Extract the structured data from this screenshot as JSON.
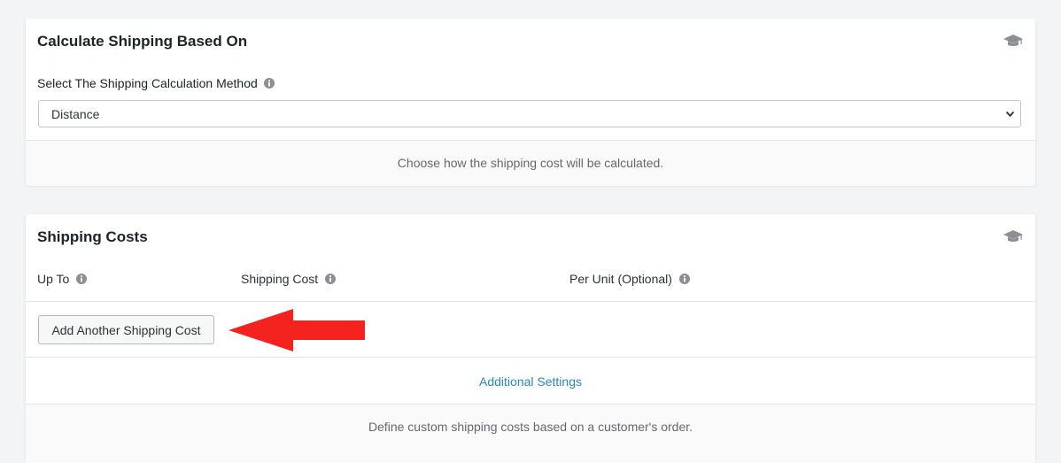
{
  "calc_card": {
    "title": "Calculate Shipping Based On",
    "field_label": "Select The Shipping Calculation Method",
    "select_value": "Distance",
    "footer": "Choose how the shipping cost will be calculated."
  },
  "costs_card": {
    "title": "Shipping Costs",
    "columns": [
      "Up To",
      "Shipping Cost",
      "Per Unit (Optional)"
    ],
    "add_button": "Add Another Shipping Cost",
    "additional_link": "Additional Settings",
    "footer": "Define custom shipping costs based on a customer's order."
  },
  "icons": {
    "help": "graduation-cap-icon",
    "info": "info-icon",
    "select": "chevron-down-icon",
    "annotation": "red-arrow"
  },
  "colors": {
    "background": "#f3f4f6",
    "link": "#2e88b4",
    "arrow": "#f4231f"
  }
}
